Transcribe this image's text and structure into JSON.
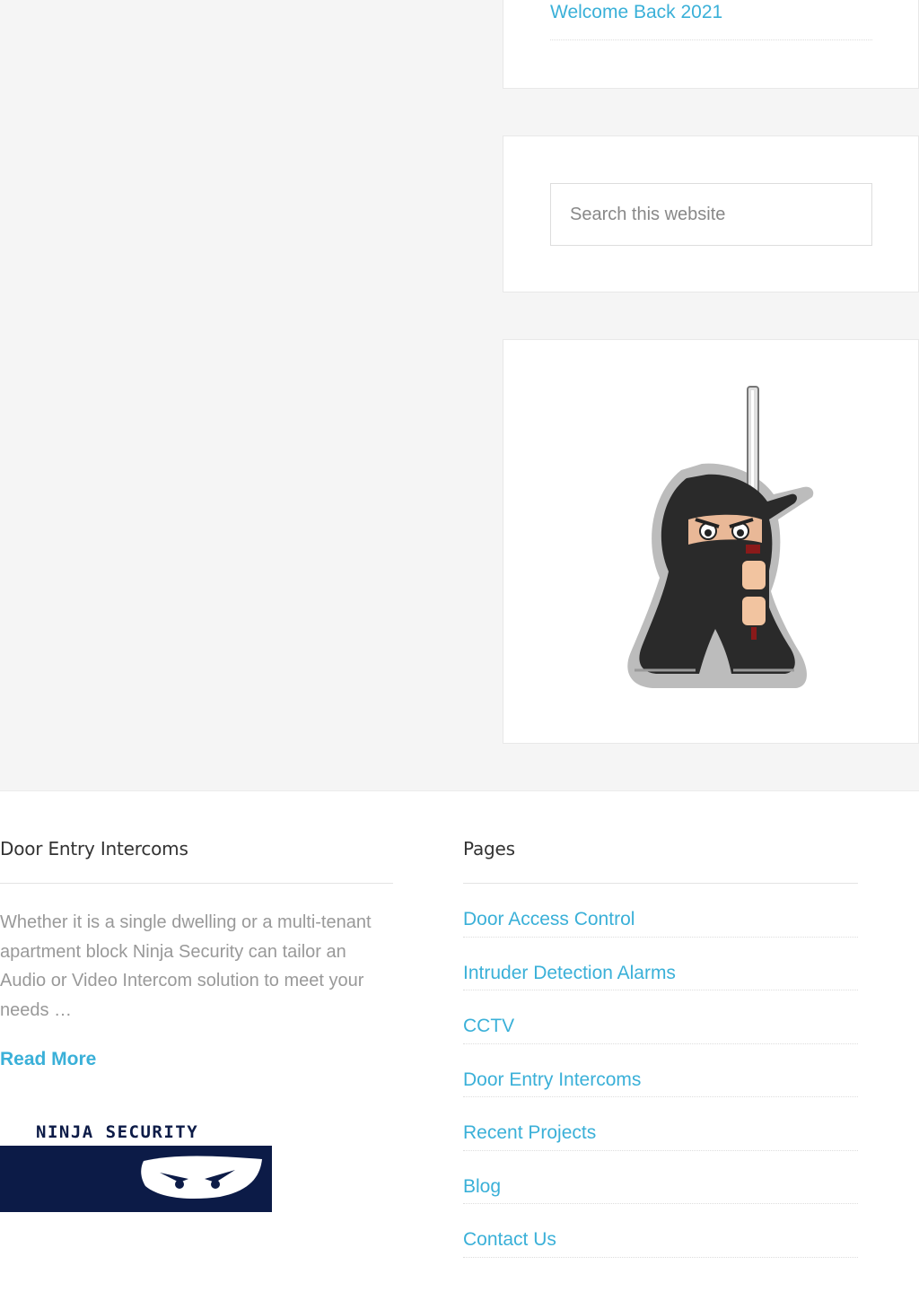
{
  "sidebar": {
    "recent_posts": {
      "items": [
        {
          "label": "Welcome Back 2021"
        }
      ]
    },
    "search": {
      "placeholder": "Search this website"
    },
    "image_widget": {
      "icon": "ninja-mascot-icon"
    }
  },
  "footer": {
    "left": {
      "title": "Door Entry Intercoms",
      "excerpt": "Whether it is a single dwelling or a multi-tenant apartment block Ninja Security can tailor an Audio or Video Intercom solution to meet your needs …",
      "read_more": "Read More",
      "logo_text": "NINJA  SECURITY"
    },
    "right": {
      "title": "Pages",
      "items": [
        {
          "label": "Door Access Control"
        },
        {
          "label": "Intruder Detection Alarms"
        },
        {
          "label": "CCTV"
        },
        {
          "label": "Door Entry Intercoms"
        },
        {
          "label": "Recent Projects"
        },
        {
          "label": "Blog"
        },
        {
          "label": "Contact Us"
        }
      ]
    }
  },
  "colors": {
    "link": "#3ab0d8",
    "background": "#f5f5f5",
    "logo_navy": "#0c1b47"
  }
}
